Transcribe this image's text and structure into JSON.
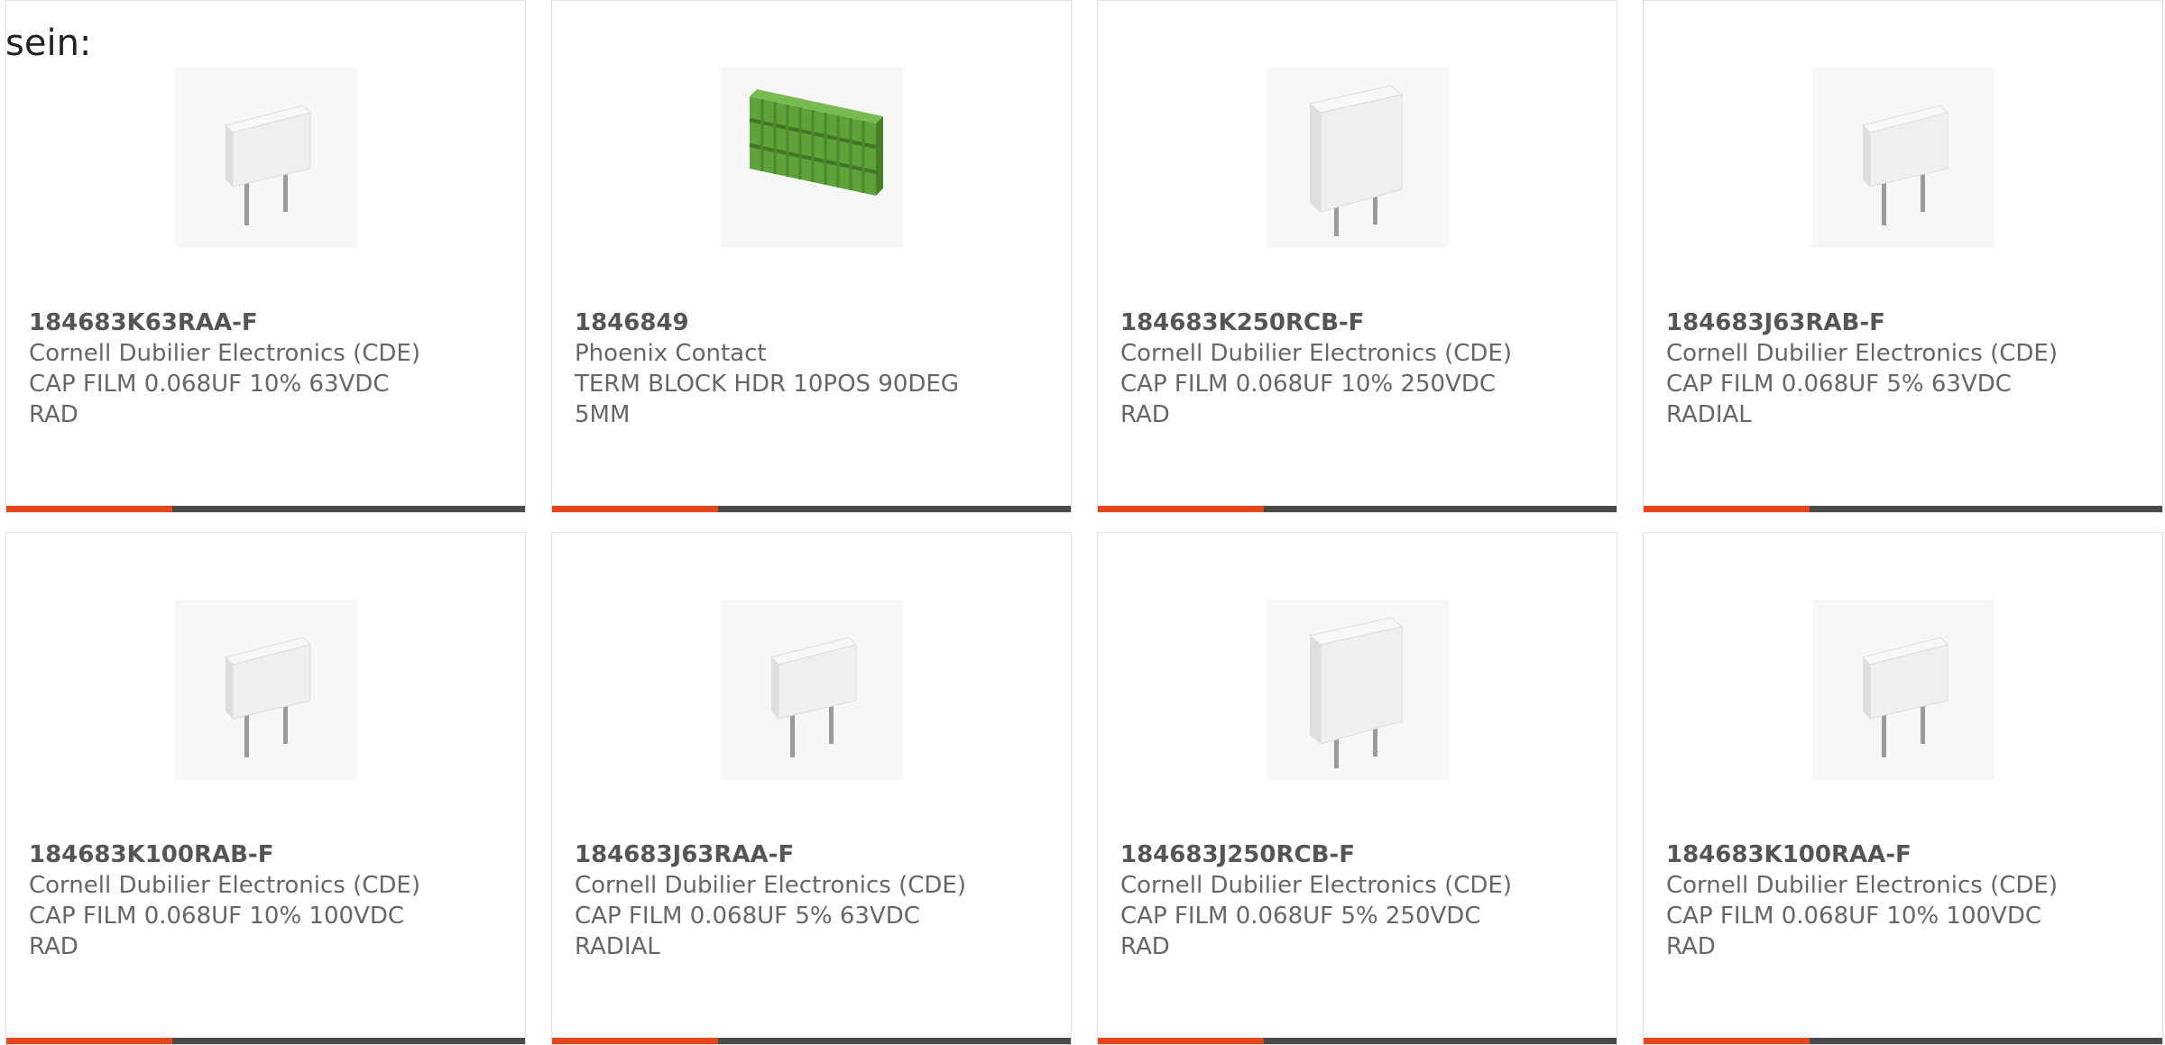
{
  "intro_text": "sein:",
  "products": [
    {
      "part_number": "184683K63RAA-F",
      "manufacturer": "Cornell Dubilier Electronics (CDE)",
      "desc_line1": "CAP FILM 0.068UF 10% 63VDC",
      "desc_line2": "RAD",
      "image": "film-capacitor-small-icon"
    },
    {
      "part_number": "1846849",
      "manufacturer": "Phoenix Contact",
      "desc_line1": "TERM BLOCK HDR 10POS 90DEG",
      "desc_line2": "5MM",
      "image": "terminal-block-icon"
    },
    {
      "part_number": "184683K250RCB-F",
      "manufacturer": "Cornell Dubilier Electronics (CDE)",
      "desc_line1": "CAP FILM 0.068UF 10% 250VDC",
      "desc_line2": "RAD",
      "image": "film-capacitor-large-icon"
    },
    {
      "part_number": "184683J63RAB-F",
      "manufacturer": "Cornell Dubilier Electronics (CDE)",
      "desc_line1": "CAP FILM 0.068UF 5% 63VDC",
      "desc_line2": "RADIAL",
      "image": "film-capacitor-small-icon"
    },
    {
      "part_number": "184683K100RAB-F",
      "manufacturer": "Cornell Dubilier Electronics (CDE)",
      "desc_line1": "CAP FILM 0.068UF 10% 100VDC",
      "desc_line2": "RAD",
      "image": "film-capacitor-small-icon"
    },
    {
      "part_number": "184683J63RAA-F",
      "manufacturer": "Cornell Dubilier Electronics (CDE)",
      "desc_line1": "CAP FILM 0.068UF 5% 63VDC",
      "desc_line2": "RADIAL",
      "image": "film-capacitor-small-icon"
    },
    {
      "part_number": "184683J250RCB-F",
      "manufacturer": "Cornell Dubilier Electronics (CDE)",
      "desc_line1": "CAP FILM 0.068UF 5% 250VDC",
      "desc_line2": "RAD",
      "image": "film-capacitor-large-icon"
    },
    {
      "part_number": "184683K100RAA-F",
      "manufacturer": "Cornell Dubilier Electronics (CDE)",
      "desc_line1": "CAP FILM 0.068UF 10% 100VDC",
      "desc_line2": "RAD",
      "image": "film-capacitor-small-icon"
    }
  ],
  "colors": {
    "accent": "#e5461a",
    "bar": "#4a4a4a",
    "text": "#666666",
    "part_number": "#555555",
    "capacitor_body": "#eeeeee",
    "terminal_block": "#5ea33a"
  }
}
